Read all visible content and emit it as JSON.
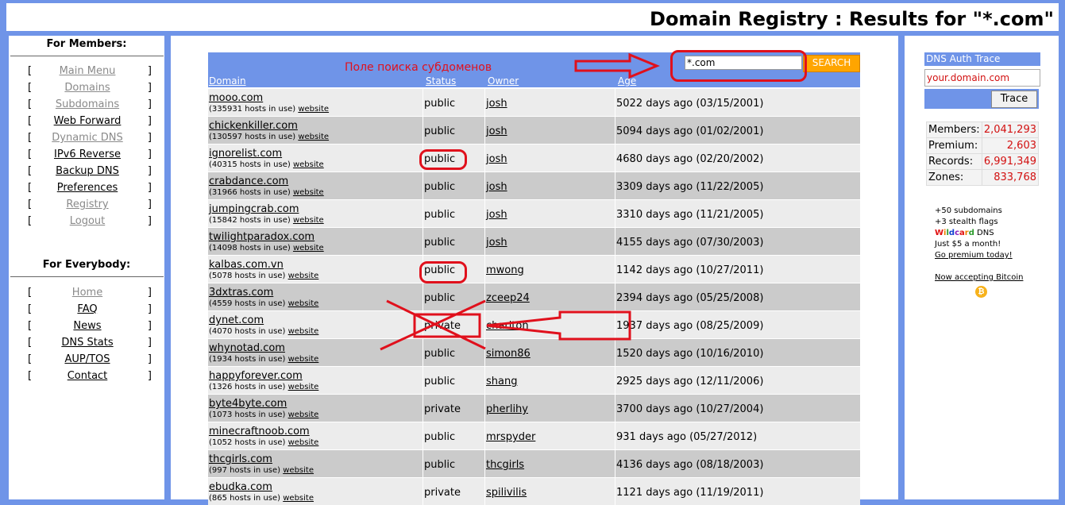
{
  "page": {
    "title": "Domain Registry : Results for \"*.com\""
  },
  "sidebar": {
    "members_title": "For Members:",
    "members": [
      {
        "label": "Main Menu",
        "active": false
      },
      {
        "label": "Domains",
        "active": false
      },
      {
        "label": "Subdomains",
        "active": false
      },
      {
        "label": "Web Forward",
        "active": true
      },
      {
        "label": "Dynamic DNS",
        "active": false
      },
      {
        "label": "IPv6 Reverse",
        "active": true
      },
      {
        "label": "Backup DNS",
        "active": true
      },
      {
        "label": "Preferences",
        "active": true
      },
      {
        "label": "Registry",
        "active": false
      },
      {
        "label": "Logout",
        "active": false
      }
    ],
    "everybody_title": "For Everybody:",
    "everybody": [
      {
        "label": "Home",
        "active": false
      },
      {
        "label": "FAQ",
        "active": true
      },
      {
        "label": "News",
        "active": true
      },
      {
        "label": "DNS Stats",
        "active": true
      },
      {
        "label": "AUP/TOS",
        "active": true
      },
      {
        "label": "Contact",
        "active": true
      }
    ],
    "bracket_open": "[",
    "bracket_close": "]"
  },
  "search": {
    "annotation": "Поле поиска субдоменов",
    "value": "*.com",
    "button_label": "SEARCH"
  },
  "table": {
    "headers": {
      "domain": "Domain",
      "status": "Status",
      "owner": "Owner",
      "age": "Age"
    },
    "website_label": "website",
    "rows": [
      {
        "domain": "mooo.com",
        "hosts": "(335931 hosts in use)",
        "status": "public",
        "owner": "josh",
        "age": "5022 days ago (03/15/2001)"
      },
      {
        "domain": "chickenkiller.com",
        "hosts": "(130597 hosts in use)",
        "status": "public",
        "owner": "josh",
        "age": "5094 days ago (01/02/2001)"
      },
      {
        "domain": "ignorelist.com",
        "hosts": "(40315 hosts in use)",
        "status": "public",
        "owner": "josh",
        "age": "4680 days ago (02/20/2002)"
      },
      {
        "domain": "crabdance.com",
        "hosts": "(31966 hosts in use)",
        "status": "public",
        "owner": "josh",
        "age": "3309 days ago (11/22/2005)"
      },
      {
        "domain": "jumpingcrab.com",
        "hosts": "(15842 hosts in use)",
        "status": "public",
        "owner": "josh",
        "age": "3310 days ago (11/21/2005)"
      },
      {
        "domain": "twilightparadox.com",
        "hosts": "(14098 hosts in use)",
        "status": "public",
        "owner": "josh",
        "age": "4155 days ago (07/30/2003)"
      },
      {
        "domain": "kalbas.com.vn",
        "hosts": "(5078 hosts in use)",
        "status": "public",
        "owner": "mwong",
        "age": "1142 days ago (10/27/2011)"
      },
      {
        "domain": "3dxtras.com",
        "hosts": "(4559 hosts in use)",
        "status": "public",
        "owner": "zceep24",
        "age": "2394 days ago (05/25/2008)"
      },
      {
        "domain": "dynet.com",
        "hosts": "(4070 hosts in use)",
        "status": "private",
        "owner": "charlton",
        "age": "1937 days ago (08/25/2009)"
      },
      {
        "domain": "whynotad.com",
        "hosts": "(1934 hosts in use)",
        "status": "public",
        "owner": "simon86",
        "age": "1520 days ago (10/16/2010)"
      },
      {
        "domain": "happyforever.com",
        "hosts": "(1326 hosts in use)",
        "status": "public",
        "owner": "shang",
        "age": "2925 days ago (12/11/2006)"
      },
      {
        "domain": "byte4byte.com",
        "hosts": "(1073 hosts in use)",
        "status": "private",
        "owner": "pherlihy",
        "age": "3700 days ago (10/27/2004)"
      },
      {
        "domain": "minecraftnoob.com",
        "hosts": "(1052 hosts in use)",
        "status": "public",
        "owner": "mrspyder",
        "age": "931 days ago (05/27/2012)"
      },
      {
        "domain": "thcgirls.com",
        "hosts": "(997 hosts in use)",
        "status": "public",
        "owner": "thcgirls",
        "age": "4136 days ago (08/18/2003)"
      },
      {
        "domain": "ebudka.com",
        "hosts": "(865 hosts in use)",
        "status": "private",
        "owner": "spilivilis",
        "age": "1121 days ago (11/19/2011)"
      }
    ]
  },
  "right": {
    "trace_title": "DNS Auth Trace",
    "trace_placeholder": "your.domain.com",
    "trace_button": "Trace",
    "stats": [
      {
        "label": "Members:",
        "value": "2,041,293"
      },
      {
        "label": "Premium:",
        "value": "2,603"
      },
      {
        "label": "Records:",
        "value": "6,991,349"
      },
      {
        "label": "Zones:",
        "value": "833,768"
      }
    ],
    "promo": {
      "line1": "+50 subdomains",
      "line2": "+3 stealth flags",
      "wildcard": "Wildcard",
      "dns": " DNS",
      "line4": "Just $5 a month!",
      "cta": "Go premium today!",
      "bitcoin": "Now accepting Bitcoin",
      "bitcoin_symbol": "₿"
    },
    "wildcard_colors": [
      "#e01010",
      "#f08000",
      "#2a9a2a",
      "#1040d0",
      "#8a20c0",
      "#e01010",
      "#f08000",
      "#2a9a2a"
    ]
  },
  "colors": {
    "accent": "#6f94e8",
    "annotation": "#e0101c",
    "search_button": "#ffa500",
    "stat_value": "#d21010"
  }
}
